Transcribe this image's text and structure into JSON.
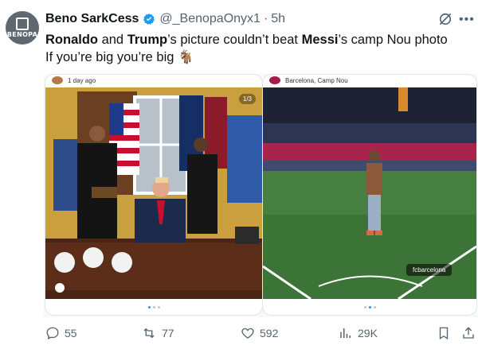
{
  "author": {
    "avatar_text": "BENOPA",
    "display_name": "Beno SarkCess",
    "handle": "@_BenopaOnyx1",
    "time": "5h"
  },
  "tweet": {
    "line1": [
      {
        "text": "Ronaldo",
        "bold": true
      },
      {
        "text": " and ",
        "bold": false
      },
      {
        "text": "Trump",
        "bold": true
      },
      {
        "text": "’s picture couldn’t beat ",
        "bold": false
      },
      {
        "text": "Messi",
        "bold": true
      },
      {
        "text": "’s camp Nou photo",
        "bold": false
      }
    ],
    "line2": "If you’re big you’re big 🐐"
  },
  "panels": [
    {
      "caption": "1 day ago",
      "counter": "1/3"
    },
    {
      "caption": "Barcelona, Camp Nou",
      "tag": "fcbarcelona"
    }
  ],
  "actions": {
    "replies": "55",
    "reposts": "77",
    "likes": "592",
    "views": "29K"
  },
  "colors": {
    "accent": "#1d9bf0",
    "text": "#0f1419",
    "muted": "#536471"
  }
}
